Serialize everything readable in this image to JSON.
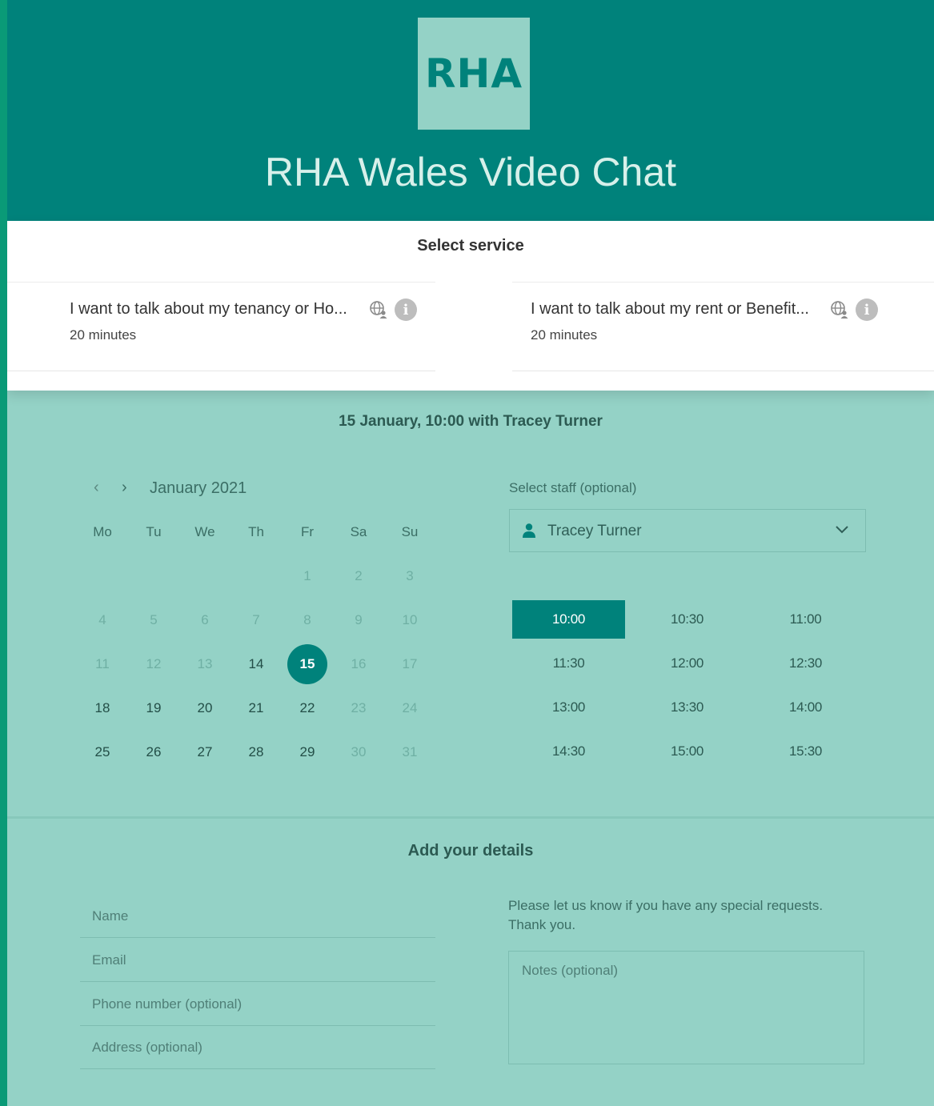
{
  "header": {
    "logo_text": "RHA",
    "title": "RHA Wales Video Chat"
  },
  "service_section": {
    "heading": "Select service",
    "services": [
      {
        "name": "I want to talk about my tenancy or Ho...",
        "duration": "20 minutes",
        "icons": [
          "globe-person-icon",
          "info-icon"
        ]
      },
      {
        "name": "I want to talk about my rent or Benefit...",
        "duration": "20 minutes",
        "icons": [
          "globe-person-icon",
          "info-icon"
        ]
      }
    ],
    "info_glyph": "i"
  },
  "booking": {
    "summary": "15 January, 10:00 with Tracey Turner",
    "calendar": {
      "prev_glyph": "‹",
      "next_glyph": "›",
      "month_label": "January 2021",
      "weekdays": [
        "Mo",
        "Tu",
        "We",
        "Th",
        "Fr",
        "Sa",
        "Su"
      ],
      "weeks": [
        [
          null,
          null,
          null,
          null,
          {
            "d": "1",
            "m": true
          },
          {
            "d": "2",
            "m": true
          },
          {
            "d": "3",
            "m": true
          }
        ],
        [
          {
            "d": "4",
            "m": true
          },
          {
            "d": "5",
            "m": true
          },
          {
            "d": "6",
            "m": true
          },
          {
            "d": "7",
            "m": true
          },
          {
            "d": "8",
            "m": true
          },
          {
            "d": "9",
            "m": true
          },
          {
            "d": "10",
            "m": true
          }
        ],
        [
          {
            "d": "11",
            "m": true
          },
          {
            "d": "12",
            "m": true
          },
          {
            "d": "13",
            "m": true
          },
          {
            "d": "14"
          },
          {
            "d": "15",
            "s": true
          },
          {
            "d": "16",
            "m": true
          },
          {
            "d": "17",
            "m": true
          }
        ],
        [
          {
            "d": "18"
          },
          {
            "d": "19"
          },
          {
            "d": "20"
          },
          {
            "d": "21"
          },
          {
            "d": "22"
          },
          {
            "d": "23",
            "m": true
          },
          {
            "d": "24",
            "m": true
          }
        ],
        [
          {
            "d": "25"
          },
          {
            "d": "26"
          },
          {
            "d": "27"
          },
          {
            "d": "28"
          },
          {
            "d": "29"
          },
          {
            "d": "30",
            "m": true
          },
          {
            "d": "31",
            "m": true
          }
        ]
      ],
      "selected_day": "15"
    },
    "staff": {
      "label": "Select staff (optional)",
      "value": "Tracey Turner"
    },
    "time_slots": [
      "10:00",
      "10:30",
      "11:00",
      "11:30",
      "12:00",
      "12:30",
      "13:00",
      "13:30",
      "14:00",
      "14:30",
      "15:00",
      "15:30"
    ],
    "selected_slot": "10:00"
  },
  "details": {
    "heading": "Add your details",
    "fields": [
      {
        "placeholder": "Name"
      },
      {
        "placeholder": "Email"
      },
      {
        "placeholder": "Phone number (optional)"
      },
      {
        "placeholder": "Address (optional)"
      }
    ],
    "requests_text": "Please let us know if you have any special requests. Thank you.",
    "notes_placeholder": "Notes (optional)"
  },
  "colors": {
    "brand": "#00827b",
    "background": "#94d2c6",
    "edge": "#0a9a77"
  }
}
